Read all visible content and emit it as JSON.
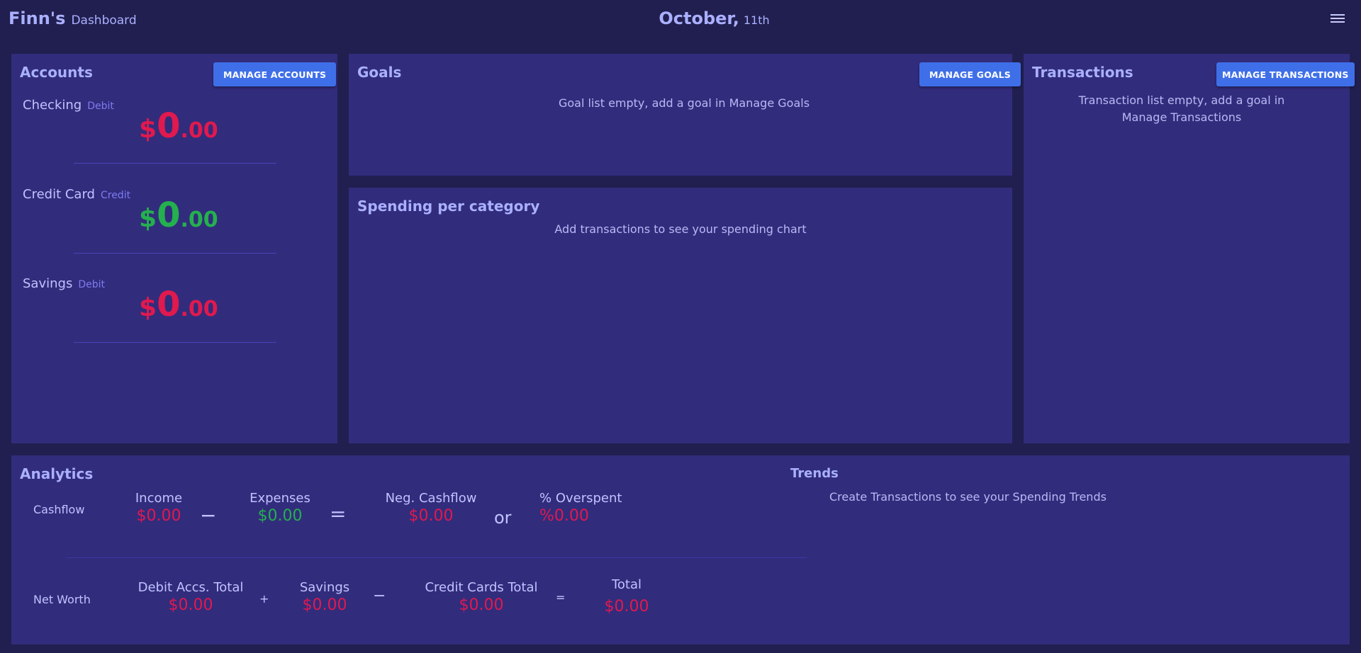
{
  "header": {
    "brand_name": "Finn's",
    "brand_sub": "Dashboard",
    "month": "October,",
    "day": "11th",
    "menu_icon": "hamburger-menu-icon"
  },
  "accounts": {
    "title": "Accounts",
    "manage_label": "MANAGE ACCOUNTS",
    "items": [
      {
        "name": "Checking",
        "type": "Debit",
        "currency": "$",
        "whole": "0",
        "decimal": ".00",
        "color": "#e0194f"
      },
      {
        "name": "Credit Card",
        "type": "Credit",
        "currency": "$",
        "whole": "0",
        "decimal": ".00",
        "color": "#24b04e"
      },
      {
        "name": "Savings",
        "type": "Debit",
        "currency": "$",
        "whole": "0",
        "decimal": ".00",
        "color": "#e0194f"
      }
    ]
  },
  "goals": {
    "title": "Goals",
    "manage_label": "MANAGE GOALS",
    "empty_text": "Goal list empty, add a goal in Manage Goals"
  },
  "spending": {
    "title": "Spending per category",
    "empty_text": "Add transactions to see your spending chart"
  },
  "transactions": {
    "title": "Transactions",
    "manage_label": "MANAGE TRANSACTIONS",
    "empty_line1": "Transaction list empty, add a goal in",
    "empty_line2": "Manage Transactions"
  },
  "analytics": {
    "title": "Analytics",
    "cashflow": {
      "label": "Cashflow",
      "income_label": "Income",
      "income_value": "$0.00",
      "minus": "−",
      "expenses_label": "Expenses",
      "expenses_value": "$0.00",
      "equals": "=",
      "neg_label": "Neg. Cashflow",
      "neg_value": "$0.00",
      "or": "or",
      "overspent_label": "% Overspent",
      "overspent_value": "%0.00"
    },
    "networth": {
      "label": "Net Worth",
      "debit_label": "Debit Accs. Total",
      "debit_value": "$0.00",
      "plus": "+",
      "savings_label": "Savings",
      "savings_value": "$0.00",
      "minus": "−",
      "credit_label": "Credit Cards Total",
      "credit_value": "$0.00",
      "equals": "=",
      "total_label": "Total",
      "total_value": "$0.00"
    }
  },
  "trends": {
    "title": "Trends",
    "empty_text": "Create Transactions to see your Spending Trends"
  },
  "colors": {
    "background": "#211f4f",
    "panel": "#322c7c",
    "button": "#3f6fe8",
    "negative": "#e0194f",
    "positive": "#24b04e"
  }
}
